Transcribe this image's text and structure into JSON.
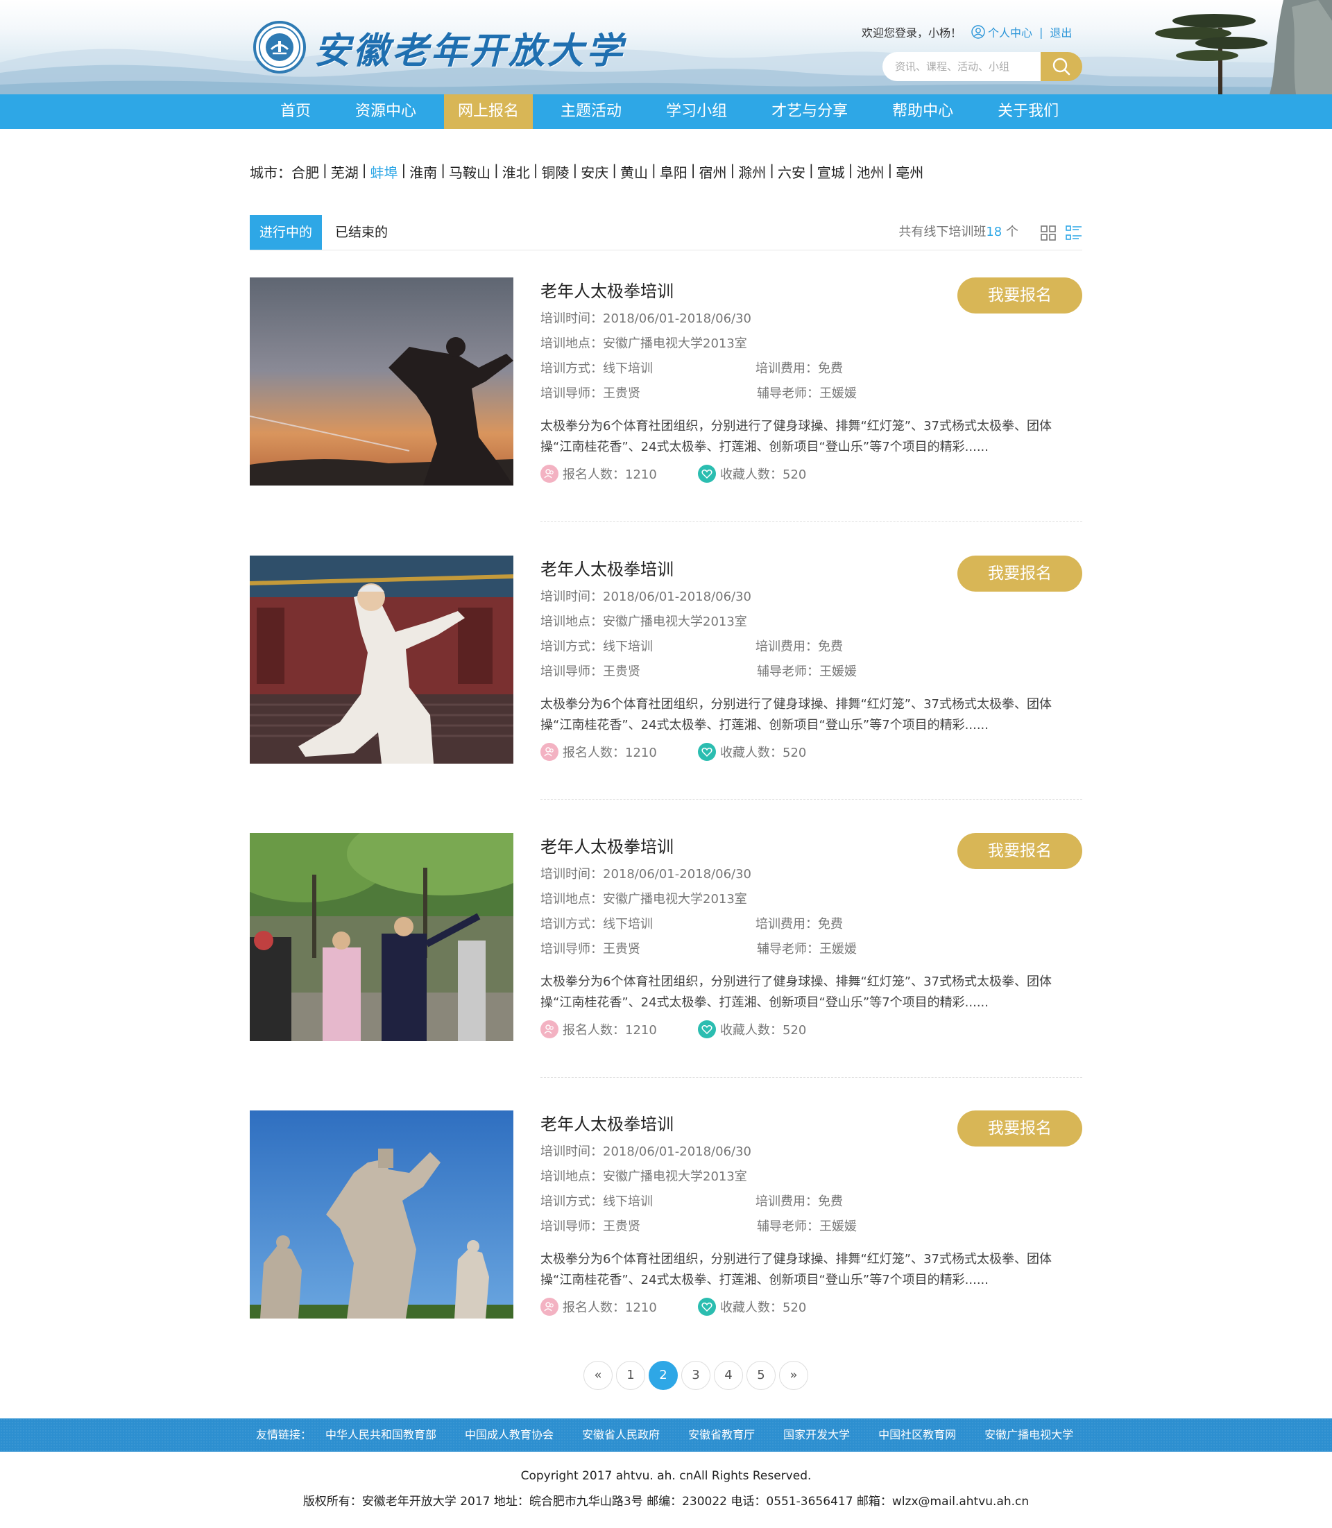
{
  "header": {
    "school_name": "安徽老年开放大学",
    "welcome": "欢迎您登录，小杨！",
    "user_center": "个人中心",
    "separator": "|",
    "logout": "退出",
    "search_placeholder": "资讯、课程、活动、小组"
  },
  "nav": [
    {
      "label": "首页",
      "active": false
    },
    {
      "label": "资源中心",
      "active": false
    },
    {
      "label": "网上报名",
      "active": true
    },
    {
      "label": "主题活动",
      "active": false
    },
    {
      "label": "学习小组",
      "active": false
    },
    {
      "label": "才艺与分享",
      "active": false
    },
    {
      "label": "帮助中心",
      "active": false
    },
    {
      "label": "关于我们",
      "active": false
    }
  ],
  "city_filter": {
    "label": "城市：",
    "selected": "蚌埠",
    "cities": [
      "合肥",
      "芜湖",
      "蚌埠",
      "淮南",
      "马鞍山",
      "淮北",
      "铜陵",
      "安庆",
      "黄山",
      "阜阳",
      "宿州",
      "滁州",
      "六安",
      "宣城",
      "池州",
      "亳州"
    ]
  },
  "tabs": {
    "ongoing": "进行中的",
    "ended": "已结束的",
    "total_prefix": "共有线下培训班",
    "total_count": "18",
    "total_suffix": " 个"
  },
  "courses": [
    {
      "image": "tai-chi-statue-sunset",
      "title": "老年人太极拳培训",
      "button": "我要报名",
      "time": "培训时间：2018/06/01-2018/06/30",
      "place": "培训地点：安徽广播电视大学2013室",
      "mode": "培训方式：线下培训",
      "fee": "培训费用：免费",
      "mentor": "培训导师：王贵贤",
      "assistant": "辅导老师：王媛媛",
      "desc": "太极拳分为6个体育社团组织，分别进行了健身球操、排舞“红灯笼”、37式杨式太极拳、团体操“江南桂花香”、24式太极拳、打莲湘、创新项目“登山乐”等7个项目的精彩......",
      "signups": "报名人数：1210",
      "favorites": "收藏人数：520"
    },
    {
      "image": "elderly-man-tai-chi-temple",
      "title": "老年人太极拳培训",
      "button": "我要报名",
      "time": "培训时间：2018/06/01-2018/06/30",
      "place": "培训地点：安徽广播电视大学2013室",
      "mode": "培训方式：线下培训",
      "fee": "培训费用：免费",
      "mentor": "培训导师：王贵贤",
      "assistant": "辅导老师：王媛媛",
      "desc": "太极拳分为6个体育社团组织，分别进行了健身球操、排舞“红灯笼”、37式杨式太极拳、团体操“江南桂花香”、24式太极拳、打莲湘、创新项目“登山乐”等7个项目的精彩......",
      "signups": "报名人数：1210",
      "favorites": "收藏人数：520"
    },
    {
      "image": "group-tai-chi-park",
      "title": "老年人太极拳培训",
      "button": "我要报名",
      "time": "培训时间：2018/06/01-2018/06/30",
      "place": "培训地点：安徽广播电视大学2013室",
      "mode": "培训方式：线下培训",
      "fee": "培训费用：免费",
      "mentor": "培训导师：王贵贤",
      "assistant": "辅导老师：王媛媛",
      "desc": "太极拳分为6个体育社团组织，分别进行了健身球操、排舞“红灯笼”、37式杨式太极拳、团体操“江南桂花香”、24式太极拳、打莲湘、创新项目“登山乐”等7个项目的精彩......",
      "signups": "报名人数：1210",
      "favorites": "收藏人数：520"
    },
    {
      "image": "stone-statues-blue-sky",
      "title": "老年人太极拳培训",
      "button": "我要报名",
      "time": "培训时间：2018/06/01-2018/06/30",
      "place": "培训地点：安徽广播电视大学2013室",
      "mode": "培训方式：线下培训",
      "fee": "培训费用：免费",
      "mentor": "培训导师：王贵贤",
      "assistant": "辅导老师：王媛媛",
      "desc": "太极拳分为6个体育社团组织，分别进行了健身球操、排舞“红灯笼”、37式杨式太极拳、团体操“江南桂花香”、24式太极拳、打莲湘、创新项目“登山乐”等7个项目的精彩......",
      "signups": "报名人数：1210",
      "favorites": "收藏人数：520"
    }
  ],
  "pagination": {
    "prev": "«",
    "pages": [
      "1",
      "2",
      "3",
      "4",
      "5"
    ],
    "current": "2",
    "next": "»"
  },
  "footer": {
    "links_label": "友情链接：",
    "links": [
      "中华人民共和国教育部",
      "中国成人教育协会",
      "安徽省人民政府",
      "安徽省教育厅",
      "国家开发大学",
      "中国社区教育网",
      "安徽广播电视大学"
    ],
    "copyright": "Copyright 2017 ahtvu. ah. cnAll Rights Reserved.",
    "address": "版权所有：安徽老年开放大学 2017 地址：皖合肥市九华山路3号 邮编：230022 电话：0551-3656417 邮箱：wlzx@mail.ahtvu.ah.cn"
  },
  "colors": {
    "primary": "#2ea7e6",
    "accent_gold": "#d8b656",
    "footer_blue": "#2d8fd0"
  }
}
